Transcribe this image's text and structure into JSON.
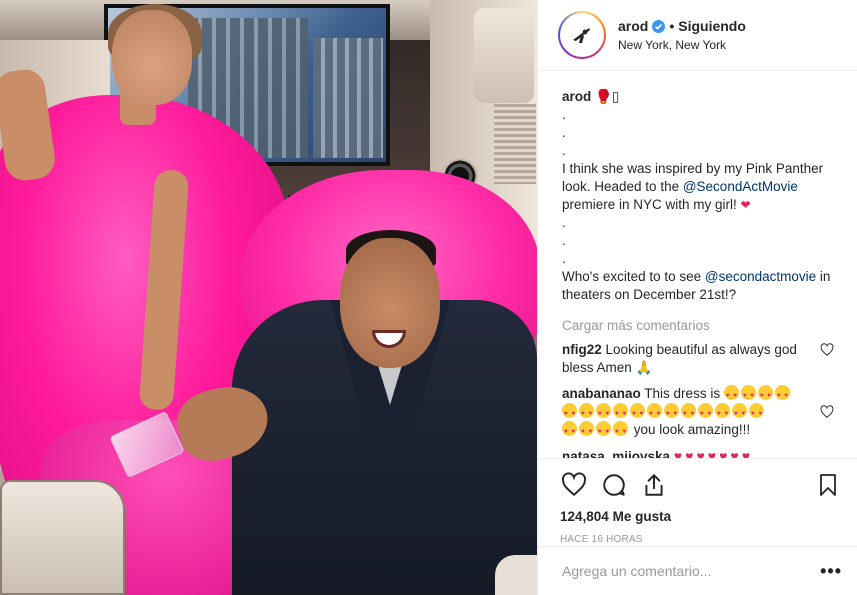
{
  "post": {
    "username": "arod",
    "follow_status": "Siguiendo",
    "separator": "•",
    "location": "New York, New York",
    "caption": {
      "user": "arod",
      "line1_emoji": "🥊▯",
      "dots_a": [
        ".",
        ".",
        "."
      ],
      "text_part1": "I think she was inspired by my Pink Panther look. Headed to the ",
      "mention1": "@SecondActMovie",
      "text_part2": " premiere in NYC with my girl! ",
      "dots_b": [
        ".",
        ".",
        "."
      ],
      "text_part3": "Who's excited to to see ",
      "mention2": "@secondactmovie",
      "text_part4": " in theaters on December 21st!?"
    },
    "load_more": "Cargar más comentarios",
    "comments": [
      {
        "user": "nfig22",
        "text": "Looking beautiful as always god bless Amen",
        "emoji": "🙏"
      },
      {
        "user": "anabananao",
        "text": "This dress is",
        "tail": "you look amazing!!!"
      },
      {
        "user": "natasa_mijovska",
        "text": ""
      }
    ],
    "likes_count": "124,804",
    "likes_label": "Me gusta",
    "timestamp": "HACE 16 HORAS",
    "comment_placeholder": "Agrega un comentario...",
    "more_label": "•••"
  },
  "colors": {
    "accent_link": "#003569",
    "muted": "#999999",
    "verified": "#3897f0",
    "heart": "#e0245e"
  }
}
